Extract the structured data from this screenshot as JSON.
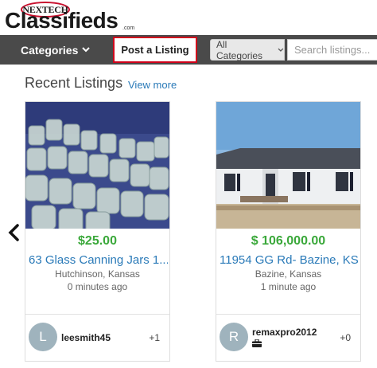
{
  "logo": {
    "badge": "NEXTECH",
    "word": "Classifieds",
    "suffix": ".com"
  },
  "nav": {
    "categories_label": "Categories",
    "post_label": "Post a Listing",
    "category_select": "All Categories",
    "search_placeholder": "Search listings..."
  },
  "section": {
    "title": "Recent Listings",
    "view_more": "View more"
  },
  "listings": [
    {
      "price": "$25.00",
      "title": "63 Glass Canning Jars 1...",
      "location": "Hutchinson, Kansas",
      "time": "0 minutes ago",
      "user": {
        "initial": "L",
        "name": "leesmith45",
        "count": "+1",
        "briefcase": false
      }
    },
    {
      "price": "$ 106,000.00",
      "title": "11954 GG Rd- Bazine, KS.",
      "location": "Bazine, Kansas",
      "time": "1 minute ago",
      "user": {
        "initial": "R",
        "name": "remaxpro2012",
        "count": "+0",
        "briefcase": true
      }
    }
  ],
  "colors": {
    "nav_bg": "#4a4a4a",
    "post_border": "#d0021b",
    "price": "#3aa83a",
    "link": "#2a7ab8"
  },
  "icons": [
    "chevron-down-icon",
    "chevron-left-icon",
    "briefcase-icon"
  ]
}
